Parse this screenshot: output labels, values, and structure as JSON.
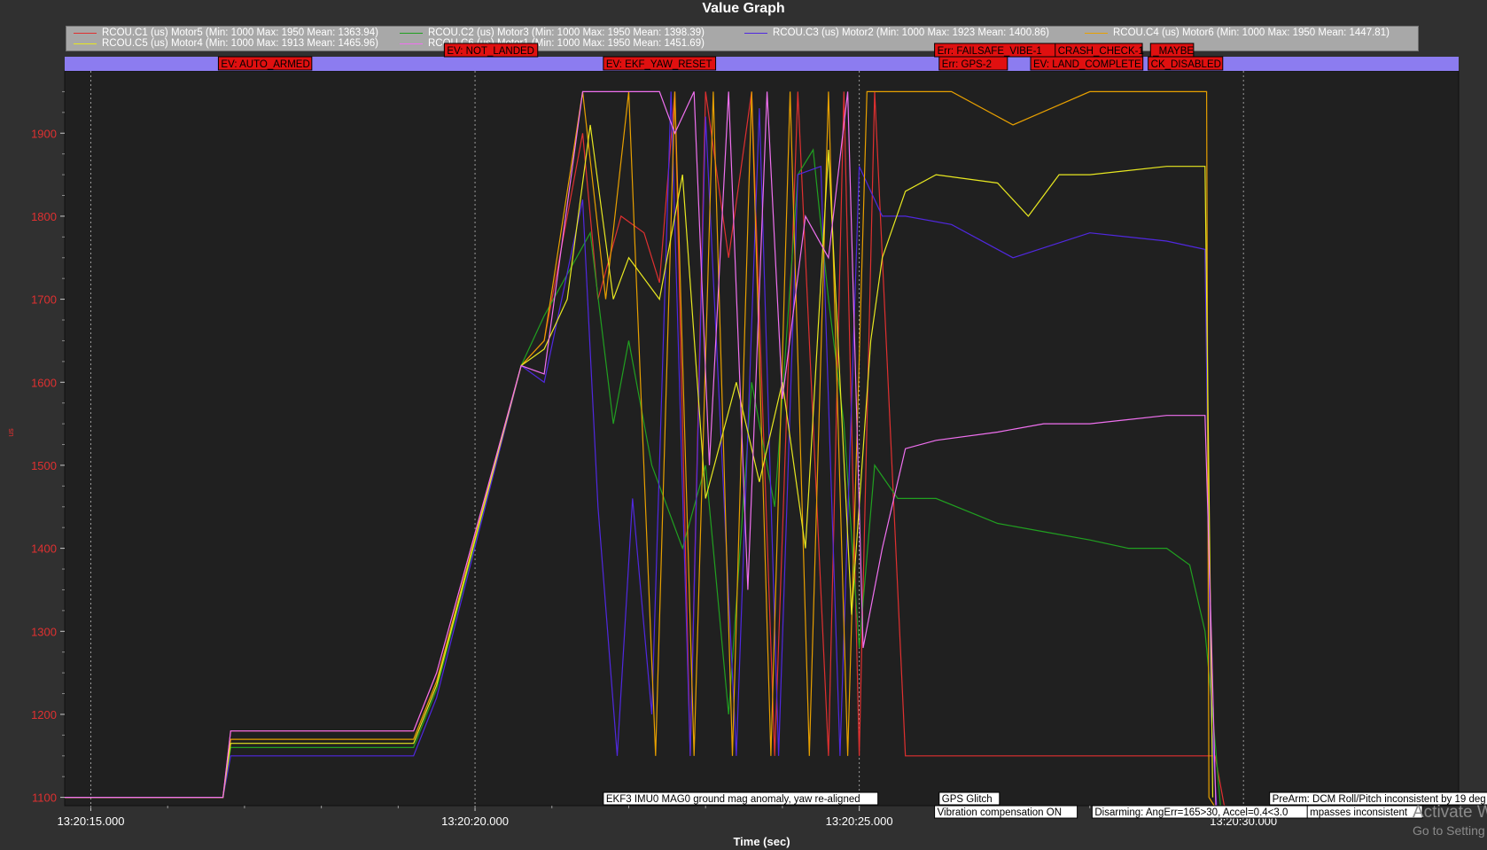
{
  "window": {
    "title": "Value Graph"
  },
  "chart_data": {
    "type": "line",
    "title": "Value Graph",
    "xlabel": "Time (sec)",
    "ylabel": "us",
    "xlim": [
      "13:20:14.660",
      "13:20:32.800"
    ],
    "ylim": [
      1090,
      1975
    ],
    "x_ticks": [
      "13:20:15.000",
      "13:20:20.000",
      "13:20:25.000",
      "13:20:30.000"
    ],
    "y_ticks": [
      1100,
      1200,
      1300,
      1400,
      1500,
      1600,
      1700,
      1800,
      1900
    ],
    "grid": "vertical dotted at major x ticks",
    "legend_position": "top",
    "series": [
      {
        "name": "RCOU.C1 (us) Motor5 (Min: 1000 Max: 1950 Mean: 1363.94)",
        "color": "#e03030",
        "x": [
          14.66,
          16.72,
          16.82,
          19.2,
          19.5,
          20.6,
          20.9,
          21.4,
          21.6,
          21.9,
          22.2,
          22.4,
          22.6,
          22.8,
          23.0,
          23.3,
          23.6,
          23.9,
          24.2,
          24.6,
          24.8,
          25.0,
          25.2,
          25.6,
          27.0,
          29.63,
          29.75,
          29.78
        ],
        "values": [
          1100,
          1100,
          1180,
          1180,
          1250,
          1620,
          1650,
          1900,
          1700,
          1800,
          1780,
          1720,
          1950,
          1150,
          1950,
          1750,
          1950,
          1150,
          1950,
          1150,
          1950,
          1150,
          1950,
          1150,
          1150,
          1150,
          1090,
          1090
        ]
      },
      {
        "name": "RCOU.C2 (us) Motor3 (Min: 1000 Max: 1950 Mean: 1398.39)",
        "color": "#20a020",
        "x": [
          14.66,
          16.72,
          16.82,
          19.2,
          19.5,
          20.6,
          20.9,
          21.5,
          21.8,
          22.0,
          22.3,
          22.7,
          23.0,
          23.3,
          23.6,
          23.9,
          24.2,
          24.4,
          24.6,
          24.8,
          25.0,
          25.2,
          25.5,
          26.0,
          26.8,
          27.4,
          28.0,
          28.5,
          29.0,
          29.3,
          29.5,
          29.6,
          29.7
        ],
        "values": [
          1100,
          1100,
          1160,
          1160,
          1230,
          1620,
          1680,
          1780,
          1550,
          1650,
          1500,
          1400,
          1500,
          1200,
          1600,
          1450,
          1850,
          1880,
          1700,
          1550,
          1280,
          1500,
          1460,
          1460,
          1430,
          1420,
          1410,
          1400,
          1400,
          1380,
          1300,
          1200,
          1090
        ]
      },
      {
        "name": "RCOU.C3 (us) Motor2 (Min: 1000 Max: 1923 Mean: 1400.86)",
        "color": "#5028e0",
        "x": [
          14.66,
          16.72,
          16.82,
          19.2,
          19.5,
          20.6,
          20.9,
          21.4,
          21.6,
          21.85,
          22.05,
          22.3,
          22.55,
          22.8,
          23.0,
          23.4,
          23.7,
          23.95,
          24.2,
          24.5,
          24.75,
          25.0,
          25.3,
          25.6,
          26.2,
          27.0,
          28.0,
          29.0,
          29.5,
          29.58,
          29.65
        ],
        "values": [
          1100,
          1100,
          1150,
          1150,
          1220,
          1620,
          1600,
          1820,
          1450,
          1150,
          1460,
          1200,
          1950,
          1150,
          1920,
          1150,
          1930,
          1150,
          1850,
          1860,
          1150,
          1860,
          1800,
          1800,
          1790,
          1750,
          1780,
          1770,
          1760,
          1200,
          1090
        ]
      },
      {
        "name": "RCOU.C4 (us) Motor6 (Min: 1000 Max: 1950 Mean: 1447.81)",
        "color": "#e8a000",
        "x": [
          14.66,
          16.72,
          16.82,
          19.2,
          19.5,
          20.6,
          20.9,
          21.4,
          21.7,
          22.0,
          22.35,
          22.6,
          22.85,
          23.1,
          23.35,
          23.6,
          23.85,
          24.1,
          24.35,
          24.6,
          24.85,
          25.1,
          25.35,
          25.6,
          26.2,
          27.0,
          28.0,
          29.0,
          29.52,
          29.55,
          29.62
        ],
        "values": [
          1100,
          1100,
          1170,
          1170,
          1240,
          1620,
          1650,
          1950,
          1700,
          1950,
          1150,
          1950,
          1150,
          1950,
          1150,
          1950,
          1150,
          1950,
          1150,
          1950,
          1150,
          1950,
          1950,
          1950,
          1950,
          1910,
          1950,
          1950,
          1950,
          1100,
          1090
        ]
      },
      {
        "name": "RCOU.C5 (us) Motor4 (Min: 1000 Max: 1913 Mean: 1465.96)",
        "color": "#e8e820",
        "x": [
          14.66,
          16.72,
          16.82,
          19.2,
          19.5,
          20.6,
          20.9,
          21.2,
          21.5,
          21.8,
          22.0,
          22.4,
          22.7,
          23.0,
          23.4,
          23.7,
          24.0,
          24.3,
          24.6,
          24.9,
          25.15,
          25.3,
          25.6,
          26.0,
          26.8,
          27.2,
          27.6,
          28.0,
          29.0,
          29.5,
          29.6
        ],
        "values": [
          1100,
          1100,
          1165,
          1165,
          1235,
          1620,
          1640,
          1700,
          1910,
          1700,
          1750,
          1700,
          1850,
          1460,
          1600,
          1480,
          1600,
          1400,
          1880,
          1320,
          1650,
          1750,
          1830,
          1850,
          1840,
          1800,
          1850,
          1850,
          1860,
          1860,
          1100
        ]
      },
      {
        "name": "RCOU.C6 (us) Motor1 (Min: 1000 Max: 1950 Mean: 1451.69)",
        "color": "#f070f0",
        "x": [
          14.66,
          16.72,
          16.82,
          19.2,
          19.5,
          20.6,
          20.9,
          21.4,
          21.7,
          22.1,
          22.4,
          22.6,
          22.85,
          23.05,
          23.3,
          23.55,
          23.8,
          24.0,
          24.3,
          24.6,
          24.85,
          25.05,
          25.3,
          25.6,
          26.0,
          26.8,
          27.4,
          28.0,
          29.0,
          29.5,
          29.58,
          29.64
        ],
        "values": [
          1100,
          1100,
          1180,
          1180,
          1250,
          1620,
          1610,
          1950,
          1950,
          1950,
          1950,
          1900,
          1950,
          1500,
          1950,
          1350,
          1950,
          1580,
          1800,
          1750,
          1950,
          1280,
          1400,
          1520,
          1530,
          1540,
          1550,
          1550,
          1560,
          1560,
          1300,
          1090
        ]
      }
    ],
    "events": [
      {
        "label": "EV: AUTO_ARMED",
        "time": 16.66,
        "row": 1
      },
      {
        "label": "EV: NOT_LANDED",
        "time": 19.6,
        "row": 0
      },
      {
        "label": "EV: EKF_YAW_RESET",
        "time": 21.67,
        "row": 1
      },
      {
        "label": "Err: FAILSAFE_VIBE-1",
        "time": 25.98,
        "row": 0
      },
      {
        "label": "Err: GPS-2",
        "time": 26.04,
        "row": 1
      },
      {
        "label": "CRASH_CHECK-1",
        "time": 27.55,
        "row": 0
      },
      {
        "label": "_MAYBE",
        "time": 28.79,
        "row": 0
      },
      {
        "label": "EV: LAND_COMPLETE",
        "time": 27.23,
        "row": 1
      },
      {
        "label": "CK_DISABLED",
        "time": 28.76,
        "row": 1
      }
    ],
    "messages": [
      {
        "label": "EKF3 IMU0 MAG0 ground mag anomaly, yaw re-aligned",
        "time": 21.67,
        "row": 0
      },
      {
        "label": "GPS Glitch",
        "time": 26.04,
        "row": 0
      },
      {
        "label": "PreArm: DCM Roll/Pitch inconsistent by 19 deg",
        "time": 30.34,
        "row": 0
      },
      {
        "label": "Vibration compensation ON",
        "time": 25.98,
        "row": 1
      },
      {
        "label": "Disarming: AngErr=165>30, Accel=0.4<3.0",
        "time": 28.03,
        "row": 1
      },
      {
        "label": "mpasses inconsistent",
        "time": 30.83,
        "row": 1
      }
    ]
  },
  "watermark": {
    "title": "Activate W",
    "subtitle": "Go to Setting"
  },
  "colors": {
    "background": "#303030",
    "plot_area": "#202020",
    "axis_text": "#e03030",
    "event_bar": "#8c7cf0",
    "event_tag": "#e01010"
  }
}
